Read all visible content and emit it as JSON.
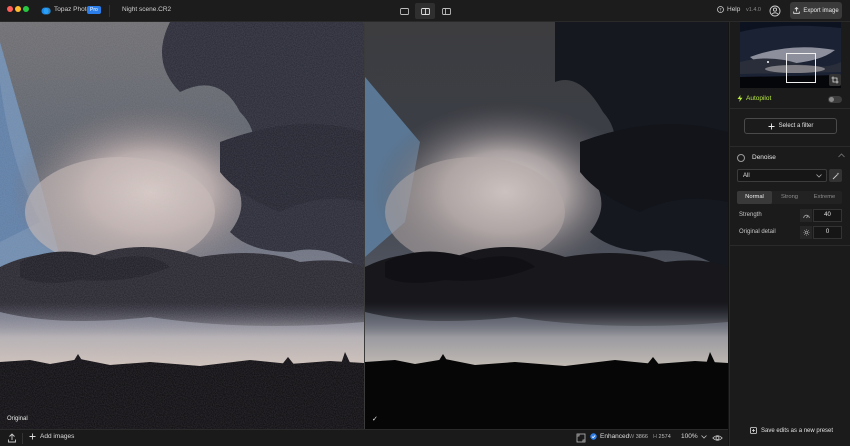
{
  "app": {
    "name": "Topaz Photo",
    "badge": "Pro",
    "file_name": "Night scene.CR2",
    "help_label": "Help",
    "version": "v1.4.0",
    "export_label": "Export image"
  },
  "view_modes": [
    {
      "icon": "single-view-icon",
      "active": false
    },
    {
      "icon": "split-view-icon",
      "active": true
    },
    {
      "icon": "side-by-side-icon",
      "active": false
    }
  ],
  "canvas": {
    "left_label": "Original",
    "right_mark": "✓"
  },
  "bottom_bar": {
    "add_images_label": "Add images",
    "enhanced_label": "Enhanced",
    "width_key": "W",
    "width_value": "3866",
    "height_key": "H",
    "height_value": "2574",
    "zoom": "100%"
  },
  "panel": {
    "autopilot_label": "Autopilot",
    "autopilot_on": false,
    "select_filter_label": "Select a filter",
    "filter_title": "Denoise",
    "dropdown_value": "All",
    "modes": [
      "Normal",
      "Strong",
      "Extreme"
    ],
    "active_mode": "Normal",
    "strength_label": "Strength",
    "strength_value": "40",
    "detail_label": "Original detail",
    "detail_value": "0",
    "preset_label": "Save edits as a new preset"
  },
  "colors": {
    "accent_autopilot": "#b9ec3f",
    "badge": "#2b7de9",
    "enhanced_dot": "#2b7de9"
  }
}
